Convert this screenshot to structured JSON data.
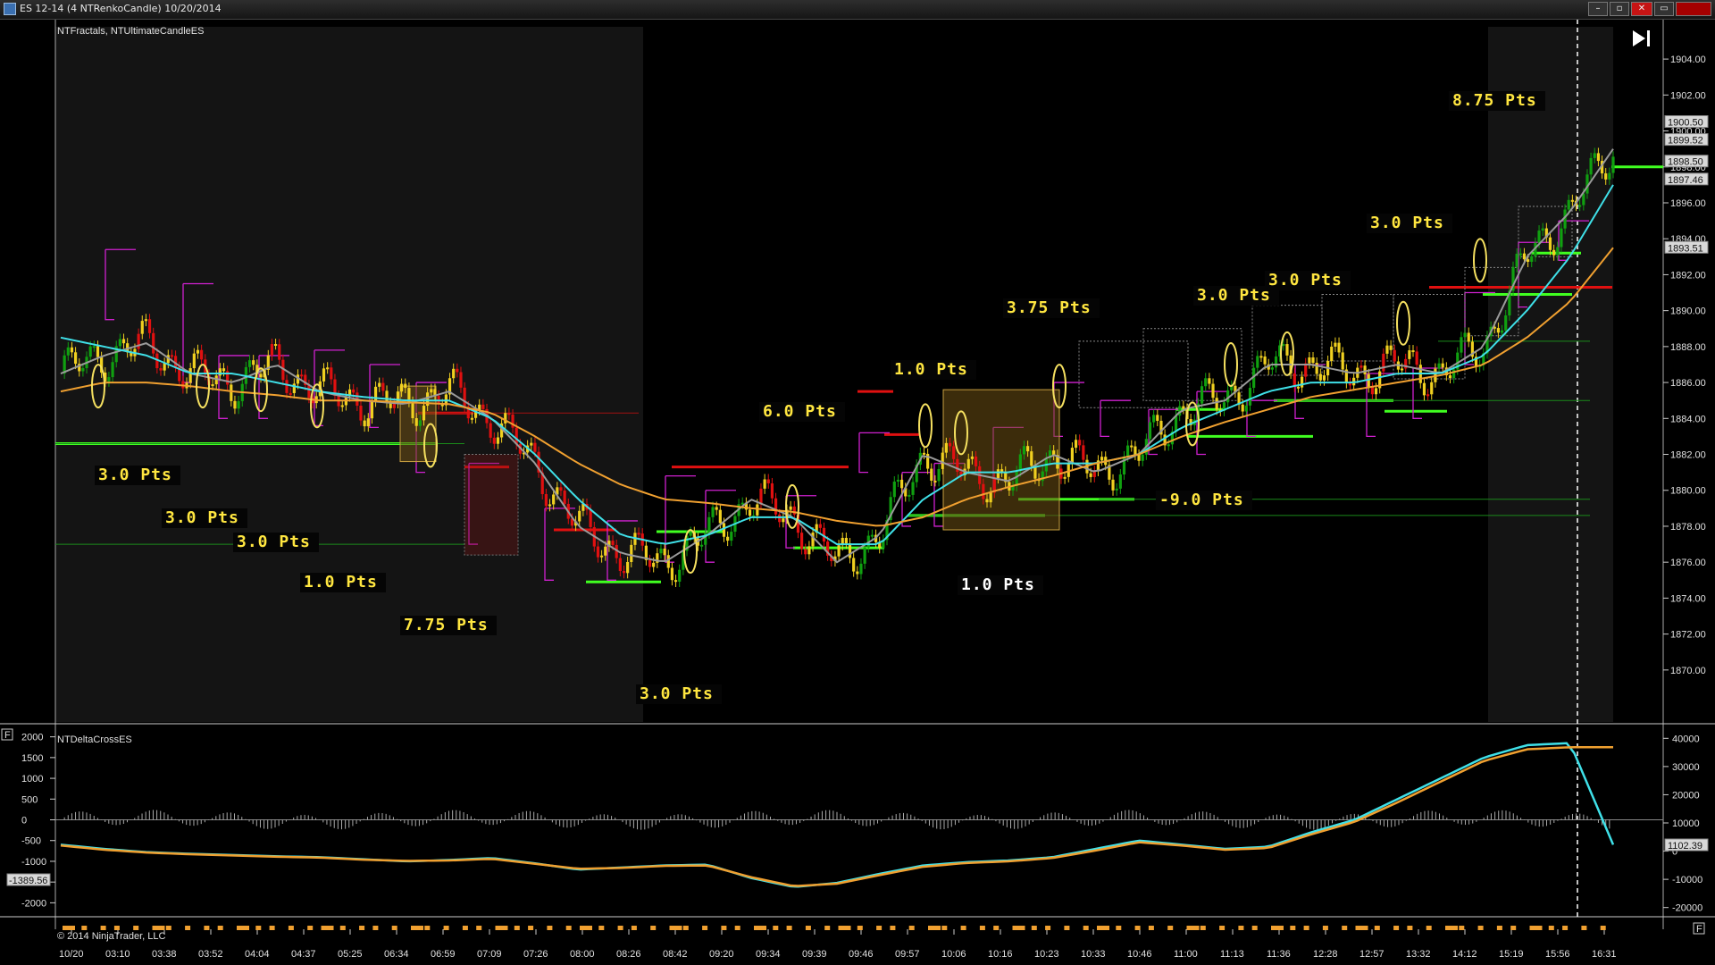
{
  "window": {
    "title": "ES 12-14 (4 NTRenkoCandle)  10/20/2014",
    "buttons": {
      "minimize": "–",
      "maximize": "▫",
      "close": "✕"
    }
  },
  "price_panel": {
    "indicator_label": "NTFractals, NTUltimateCandleES"
  },
  "delta_panel": {
    "indicator_label": "NTDeltaCrossES",
    "last_value": "1102.39",
    "left_value": "-1389.56",
    "f_badge": "F"
  },
  "copyright": "© 2014 NinjaTrader, LLC",
  "price_tags": [
    "1900.50",
    "1899.52",
    "1898.50",
    "1897.46",
    "1893.51"
  ],
  "colors": {
    "background": "#000000",
    "session_shade": "#161616",
    "cyan_ma": "#3fe0e8",
    "orange_ma": "#f0a030",
    "gray_ma": "#9a9a9a",
    "magenta": "#d020d0",
    "label_yellow": "#ffe640",
    "label_white": "#ffffff",
    "bull": "#10a010",
    "bull_bright": "#40ff20",
    "bear": "#e01010",
    "neutral": "#f0d020"
  },
  "chart_data": [
    {
      "type": "line",
      "title": "",
      "ylim": [
        1868.5,
        1905
      ],
      "y_ticks": [
        1870,
        1872,
        1874,
        1876,
        1878,
        1880,
        1882,
        1884,
        1886,
        1888,
        1890,
        1892,
        1894,
        1896,
        1898,
        1900,
        1902,
        1904
      ],
      "x_ticks": [
        "10/20",
        "03:10",
        "03:38",
        "03:52",
        "04:04",
        "04:37",
        "05:25",
        "06:34",
        "06:59",
        "07:09",
        "07:26",
        "08:00",
        "08:26",
        "08:42",
        "09:20",
        "09:34",
        "09:39",
        "09:46",
        "09:57",
        "10:06",
        "10:16",
        "10:23",
        "10:33",
        "10:46",
        "11:00",
        "11:13",
        "11:36",
        "12:28",
        "12:57",
        "13:32",
        "14:12",
        "15:19",
        "15:56",
        "16:31"
      ],
      "grid": false,
      "series": [
        {
          "values": [
            1886.5,
            1887.5,
            1888.2,
            1886.5,
            1886.0,
            1887.0,
            1885.5,
            1885.0,
            1884.8,
            1885.5,
            1884.0,
            1881.5,
            1878.0,
            1876.5,
            1876.0,
            1877.5,
            1879.5,
            1878.5,
            1876.0,
            1877.5,
            1882.0,
            1881.0,
            1880.5,
            1882.0,
            1881.0,
            1882.0,
            1884.5,
            1885.0,
            1887.0,
            1887.0,
            1886.5,
            1887.0,
            1886.5,
            1888.0,
            1893.0,
            1895.5,
            1899.0
          ]
        },
        {
          "values": [
            1888.5,
            1888.0,
            1887.5,
            1886.5,
            1886.5,
            1886.0,
            1885.5,
            1885.2,
            1885.0,
            1885.0,
            1884.0,
            1882.0,
            1879.5,
            1877.5,
            1877.0,
            1877.5,
            1878.5,
            1878.5,
            1877.0,
            1877.0,
            1879.5,
            1881.0,
            1881.0,
            1881.5,
            1881.5,
            1882.0,
            1883.5,
            1884.5,
            1885.5,
            1886.0,
            1886.0,
            1886.5,
            1886.5,
            1887.5,
            1890.0,
            1893.0,
            1897.0
          ]
        },
        {
          "values": [
            1885.5,
            1886.0,
            1886.0,
            1885.8,
            1885.5,
            1885.3,
            1885.0,
            1885.0,
            1884.9,
            1884.8,
            1884.3,
            1883.0,
            1881.5,
            1880.3,
            1879.5,
            1879.3,
            1879.0,
            1878.8,
            1878.3,
            1878.0,
            1878.5,
            1879.5,
            1880.2,
            1880.8,
            1881.5,
            1882.0,
            1883.0,
            1883.8,
            1884.5,
            1885.2,
            1885.6,
            1886.0,
            1886.4,
            1887.0,
            1888.5,
            1890.5,
            1893.5
          ]
        }
      ],
      "annotations": [
        "3.0 Pts",
        "3.0 Pts",
        "3.0 Pts",
        "1.0 Pts",
        "7.75 Pts",
        "3.0 Pts",
        "6.0 Pts",
        "1.0 Pts",
        "1.0 Pts",
        "3.75 Pts",
        "3.0 Pts",
        "3.0 Pts",
        "-9.0 Pts",
        "3.0 Pts",
        "8.75 Pts"
      ]
    },
    {
      "type": "line",
      "title": "",
      "ylim_left": [
        -2250,
        2100
      ],
      "y_ticks_left": [
        2000,
        1500,
        1000,
        500,
        0,
        -500,
        -1000,
        -1500,
        -2000
      ],
      "ylim_right": [
        -22000,
        42000
      ],
      "y_ticks_right": [
        40000,
        30000,
        20000,
        10000,
        0,
        -10000,
        -20000
      ],
      "series": [
        {
          "values": [
            -600,
            -700,
            -780,
            -820,
            -850,
            -880,
            -900,
            -950,
            -1000,
            -970,
            -920,
            -1050,
            -1200,
            -1150,
            -1100,
            -1080,
            -1400,
            -1620,
            -1520,
            -1300,
            -1100,
            -1020,
            -980,
            -900,
            -700,
            -500,
            -600,
            -700,
            -650,
            -300,
            0,
            500,
            1000,
            1500,
            1800,
            1850,
            -600
          ]
        },
        {
          "values": [
            -620,
            -720,
            -790,
            -830,
            -860,
            -890,
            -910,
            -960,
            -990,
            -980,
            -940,
            -1060,
            -1180,
            -1160,
            -1110,
            -1100,
            -1380,
            -1600,
            -1540,
            -1330,
            -1130,
            -1040,
            -1000,
            -920,
            -740,
            -540,
            -620,
            -720,
            -680,
            -350,
            -50,
            420,
            920,
            1420,
            1700,
            1750,
            1750
          ]
        }
      ]
    }
  ]
}
